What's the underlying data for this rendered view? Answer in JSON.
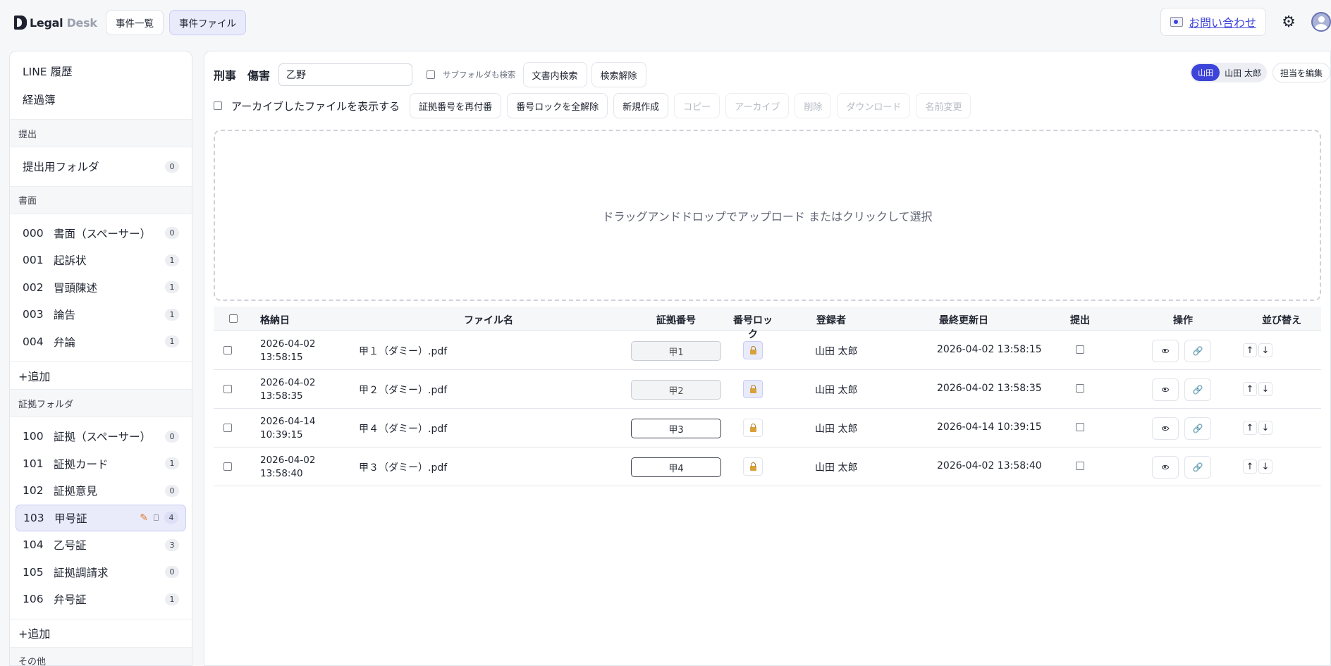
{
  "app": {
    "logo_main": "Legal",
    "logo_sub": "Desk",
    "nav": [
      {
        "label": "事件一覧"
      },
      {
        "label": "事件ファイル"
      }
    ],
    "contact_label": "お問い合わせ"
  },
  "sidebar": {
    "top_items": [
      {
        "label": "LINE 履歴"
      },
      {
        "label": "経過簿"
      }
    ],
    "sections": {
      "submit": {
        "title": "提出",
        "items": [
          {
            "label": "提出用フォルダ",
            "count": "0"
          }
        ]
      },
      "documents": {
        "title": "書面",
        "items": [
          {
            "code": "000",
            "label": "書面（スペーサー）",
            "count": "0"
          },
          {
            "code": "001",
            "label": "起訴状",
            "count": "1"
          },
          {
            "code": "002",
            "label": "冒頭陳述",
            "count": "1"
          },
          {
            "code": "003",
            "label": "論告",
            "count": "1"
          },
          {
            "code": "004",
            "label": "弁論",
            "count": "1"
          }
        ],
        "add_label": "+追加"
      },
      "evidence": {
        "title": "証拠フォルダ",
        "items": [
          {
            "code": "100",
            "label": "証拠（スペーサー）",
            "count": "0"
          },
          {
            "code": "101",
            "label": "証拠カード",
            "count": "1"
          },
          {
            "code": "102",
            "label": "証拠意見",
            "count": "0"
          },
          {
            "code": "103",
            "label": "甲号証",
            "count": "4"
          },
          {
            "code": "104",
            "label": "乙号証",
            "count": "3"
          },
          {
            "code": "105",
            "label": "証拠調請求",
            "count": "0"
          },
          {
            "code": "106",
            "label": "弁号証",
            "count": "1"
          }
        ],
        "add_label": "+追加"
      },
      "other": {
        "title": "その他"
      }
    }
  },
  "main": {
    "case_type": "刑事",
    "case_name": "傷害",
    "search_value": "乙野",
    "subfolder_label": "サブフォルダも検索",
    "search_btn": "文書内検索",
    "clear_btn": "検索解除",
    "archive_label": "アーカイブしたファイルを表示する",
    "toolbar": {
      "renumber": "証拠番号を再付番",
      "unlock_all": "番号ロックを全解除",
      "create": "新規作成",
      "copy": "コピー",
      "archive": "アーカイブ",
      "delete": "削除",
      "download": "ダウンロード",
      "rename": "名前変更"
    },
    "assignee_short": "山田",
    "assignee_full": "山田 太郎",
    "edit_assignee": "担当を編集",
    "dropzone_text": "ドラッグアンドドロップでアップロード またはクリックして選択"
  },
  "table": {
    "headers": {
      "date": "格納日",
      "name": "ファイル名",
      "evidence": "証拠番号",
      "lock": "番号ロック",
      "registrant": "登録者",
      "updated": "最終更新日",
      "submit": "提出",
      "ops": "操作",
      "sort": "並び替え"
    },
    "rows": [
      {
        "date": "2026-04-02",
        "time": "13:58:15",
        "name": "甲１（ダミー）.pdf",
        "evidence": "甲1",
        "locked": true,
        "registrant": "山田 太郎",
        "updated": "2026-04-02 13:58:15"
      },
      {
        "date": "2026-04-02",
        "time": "13:58:35",
        "name": "甲２（ダミー）.pdf",
        "evidence": "甲2",
        "locked": true,
        "registrant": "山田 太郎",
        "updated": "2026-04-02 13:58:35"
      },
      {
        "date": "2026-04-14",
        "time": "10:39:15",
        "name": "甲４（ダミー）.pdf",
        "evidence": "甲3",
        "locked": false,
        "registrant": "山田 太郎",
        "updated": "2026-04-14 10:39:15"
      },
      {
        "date": "2026-04-02",
        "time": "13:58:40",
        "name": "甲３（ダミー）.pdf",
        "evidence": "甲4",
        "locked": false,
        "registrant": "山田 太郎",
        "updated": "2026-04-02 13:58:40"
      }
    ]
  }
}
